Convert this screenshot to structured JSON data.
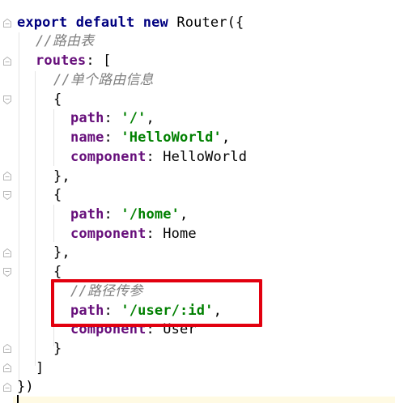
{
  "editor": {
    "lines": [
      {
        "line_1_kw": "export default new ",
        "line_1_rest": "Router({"
      }
    ],
    "line1": {
      "kw": "export default new ",
      "rest": "Router({"
    },
    "line2": {
      "comment": "//路由表"
    },
    "line3": {
      "prop": "routes",
      "rest": ": ["
    },
    "line4": {
      "comment": "//单个路由信息"
    },
    "line5": {
      "text": "{"
    },
    "line6": {
      "prop": "path",
      "sep": ": ",
      "str": "'/'",
      "end": ","
    },
    "line7": {
      "prop": "name",
      "sep": ": ",
      "str": "'HelloWorld'",
      "end": ","
    },
    "line8": {
      "prop": "component",
      "rest": ": HelloWorld"
    },
    "line9": {
      "text": "},"
    },
    "line10": {
      "text": "{"
    },
    "line11": {
      "prop": "path",
      "sep": ": ",
      "str": "'/home'",
      "end": ","
    },
    "line12": {
      "prop": "component",
      "rest": ": Home"
    },
    "line13": {
      "text": "},"
    },
    "line14": {
      "text": "{"
    },
    "line15": {
      "comment": "//路径传参"
    },
    "line16": {
      "prop": "path",
      "sep": ": ",
      "str": "'/user/:id'",
      "end": ","
    },
    "line17": {
      "prop": "component",
      "rest": ": User"
    },
    "line18": {
      "text": "}"
    },
    "line19": {
      "text": "]"
    },
    "line20": {
      "text": "})"
    }
  },
  "colors": {
    "keyword": "#000080",
    "property": "#660e7a",
    "string": "#008000",
    "comment": "#808080",
    "annotation_box": "#e2000f"
  }
}
